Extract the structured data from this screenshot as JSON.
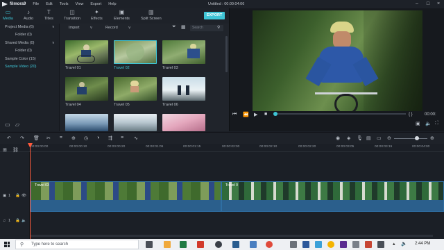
{
  "app": {
    "name": "filmora9",
    "menu": [
      "File",
      "Edit",
      "Tools",
      "View",
      "Export",
      "Help"
    ],
    "window_title": "Untitled : 00:00:04:06"
  },
  "toolbar": {
    "tabs": [
      {
        "label": "Media",
        "icon": "folder-icon"
      },
      {
        "label": "Audio",
        "icon": "music-note-icon"
      },
      {
        "label": "Titles",
        "icon": "text-icon"
      },
      {
        "label": "Transition",
        "icon": "transition-icon"
      },
      {
        "label": "Effects",
        "icon": "effects-icon"
      },
      {
        "label": "Elements",
        "icon": "elements-icon"
      },
      {
        "label": "Split Screen",
        "icon": "split-screen-icon"
      }
    ],
    "export_label": "EXPORT"
  },
  "sidebar": {
    "items": [
      {
        "label": "Project Media (6)",
        "chevron": "v"
      },
      {
        "label": "Folder (0)"
      },
      {
        "label": "Shared Media (0)",
        "chevron": "v"
      },
      {
        "label": "Folder (0)"
      },
      {
        "label": "Sample Color (15)"
      },
      {
        "label": "Sample Video (20)"
      }
    ]
  },
  "media": {
    "import_label": "Import",
    "record_label": "Record",
    "search_placeholder": "Search",
    "thumbnails": [
      {
        "label": "Travel 01"
      },
      {
        "label": "Travel 02"
      },
      {
        "label": "Travel 03"
      },
      {
        "label": "Travel 04"
      },
      {
        "label": "Travel 05"
      },
      {
        "label": "Travel 06"
      },
      {
        "label": ""
      },
      {
        "label": ""
      },
      {
        "label": ""
      }
    ]
  },
  "preview": {
    "time": "00:00:",
    "braces": "{ }"
  },
  "ruler": {
    "ticks": [
      "00:00:00:00",
      "00:00:00:10",
      "00:00:00:20",
      "00:00:01:05",
      "00:00:01:15",
      "00:00:02:00",
      "00:00:02:10",
      "00:00:02:20",
      "00:00:03:05",
      "00:00:03:15",
      "00:00:04:00"
    ]
  },
  "timeline": {
    "video_track_label": "1",
    "audio_track_label": "1",
    "clips": [
      {
        "name": "Travel 03"
      },
      {
        "name": "Travel 0"
      }
    ]
  },
  "taskbar": {
    "search_placeholder": "Type here to search",
    "time": "2:44 PM"
  }
}
